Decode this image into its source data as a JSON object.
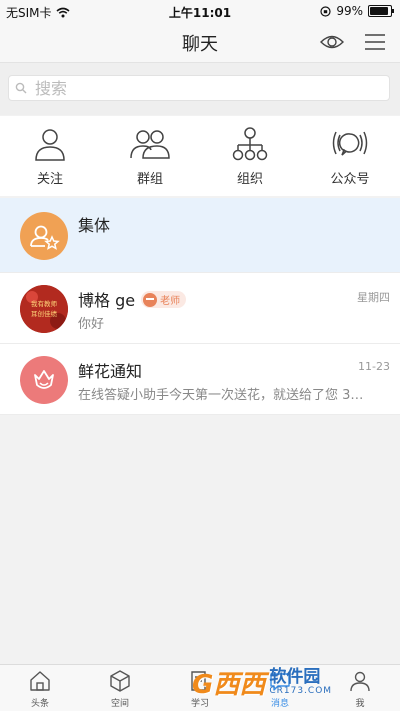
{
  "status_bar": {
    "carrier": "无SIM卡",
    "time": "上午11:01",
    "battery_percent": "99%"
  },
  "header": {
    "title": "聊天"
  },
  "search": {
    "placeholder": "搜索"
  },
  "quick_actions": [
    {
      "label": "关注",
      "icon": "person-icon"
    },
    {
      "label": "群组",
      "icon": "group-icon"
    },
    {
      "label": "组织",
      "icon": "org-chart-icon"
    },
    {
      "label": "公众号",
      "icon": "broadcast-chat-icon"
    }
  ],
  "conversations": [
    {
      "name": "集体",
      "subtitle": "",
      "time": "",
      "icon": "group-star-avatar",
      "color": "#f0a154"
    },
    {
      "name": "博格 ge",
      "badge": "老师",
      "subtitle": "你好",
      "time": "星期四",
      "icon": "user-photo-avatar",
      "color": "#b22a1f"
    },
    {
      "name": "鲜花通知",
      "subtitle": "在线答疑小助手今天第一次送花，就送给了您 3…",
      "time": "11-23",
      "icon": "flower-avatar",
      "color": "#ec7a7a"
    }
  ],
  "avatar_text": "我有教师 耳创佳绩",
  "tabbar": {
    "tabs": [
      {
        "label": "头条",
        "icon": "home-icon"
      },
      {
        "label": "空间",
        "icon": "cube-icon"
      },
      {
        "label": "学习",
        "icon": "book-icon"
      },
      {
        "label": "消息",
        "icon": "message-icon",
        "active": true
      },
      {
        "label": "我",
        "icon": "me-icon"
      }
    ]
  },
  "watermark": {
    "logo": "G西西",
    "text": "软件园",
    "sub": "CR173.COM"
  },
  "colors": {
    "accent": "#3a8ee6",
    "highlight_row": "#e8f2fc",
    "badge": "#e8835a"
  }
}
